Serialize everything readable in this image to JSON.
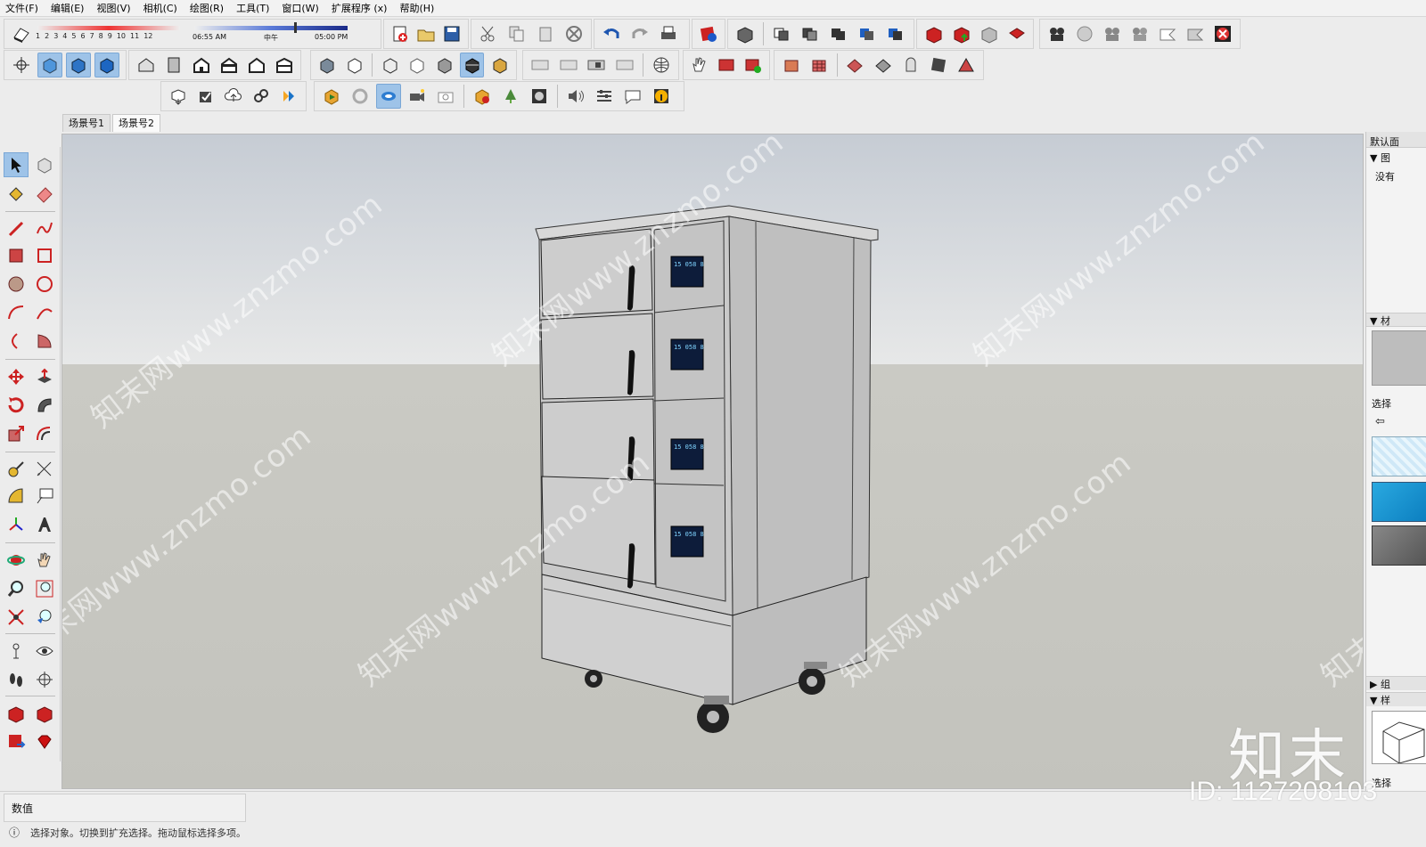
{
  "menu": [
    "文件(F)",
    "编辑(E)",
    "视图(V)",
    "相机(C)",
    "绘图(R)",
    "工具(T)",
    "窗口(W)",
    "扩展程序 (x)",
    "帮助(H)"
  ],
  "shadow_toolbar": {
    "month_numbers": [
      "1",
      "2",
      "3",
      "4",
      "5",
      "6",
      "7",
      "8",
      "9",
      "10",
      "11",
      "12"
    ],
    "time_start": "06:55 AM",
    "time_mid": "中午",
    "time_end": "05:00 PM"
  },
  "scene_tabs": [
    "场景号1",
    "场景号2"
  ],
  "active_scene": "场景号2",
  "right_panel": {
    "tray_title": "默认面",
    "section1": "图",
    "section1_text": "没有",
    "section2": "材",
    "select_label": "选择",
    "section3": "组",
    "section4": "样",
    "select_label2": "选择"
  },
  "statusbar": {
    "measurements_label": "数值",
    "hint": "选择对象。切换到扩充选择。拖动鼠标选择多项。"
  },
  "watermark": {
    "repeated_text": "知末网www.znzmo.com",
    "brand": "知末",
    "id": "ID: 1127208103"
  },
  "model_panels": {
    "display_text": "15 058 8"
  },
  "colors": {
    "sky_top": "#c9cfd6",
    "ground": "#c6c6c0",
    "cabinet": "#c4c4c4",
    "selection_blue": "#9ec3e8"
  }
}
